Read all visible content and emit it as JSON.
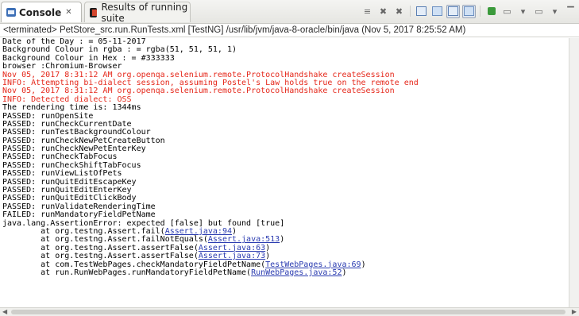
{
  "tabs": {
    "console_label": "Console",
    "console_close": "✕",
    "results_label": "Results of running suite"
  },
  "toolbar": {
    "icons": [
      "remove-all-terminated-icon",
      "terminate-icon",
      "remove-launch-icon",
      "clear-console-icon",
      "scroll-lock-icon",
      "word-wrap-icon",
      "show-on-output-icon",
      "pin-console-icon",
      "display-selected-console-icon",
      "open-console-icon",
      "minimize-icon"
    ]
  },
  "header": {
    "text": "<terminated> PetStore_src.run.RunTests.xml [TestNG] /usr/lib/jvm/java-8-oracle/bin/java (Nov 5, 2017 8:25:52 AM)"
  },
  "output": {
    "lines": [
      "Date of the Day : = 05-11-2017",
      "Background Colour in rgba : = rgba(51, 51, 51, 1)",
      "Background Colour in Hex : = #333333",
      "browser :Chromium-Browser",
      "Nov 05, 2017 8:31:12 AM org.openqa.selenium.remote.ProtocolHandshake createSession",
      "INFO: Attempting bi-dialect session, assuming Postel's Law holds true on the remote end",
      "Nov 05, 2017 8:31:12 AM org.openqa.selenium.remote.ProtocolHandshake createSession",
      "INFO: Detected dialect: OSS",
      "The rendering time is: 1344ms",
      "PASSED: runOpenSite",
      "PASSED: runCheckCurrentDate",
      "PASSED: runTestBackgroundColour",
      "PASSED: runCheckNewPetCreateButton",
      "PASSED: runCheckNewPetEnterKey",
      "PASSED: runCheckTabFocus",
      "PASSED: runCheckShiftTabFocus",
      "PASSED: runViewListOfPets",
      "PASSED: runQuitEditEscapeKey",
      "PASSED: runQuitEditEnterKey",
      "PASSED: runQuitEditClickBody",
      "PASSED: runValidateRenderingTime",
      "FAILED: runMandatoryFieldPetName",
      "java.lang.AssertionError: expected [false] but found [true]"
    ],
    "error_lines": [
      4,
      5,
      6,
      7
    ],
    "stack": [
      {
        "prefix": "        at org.testng.Assert.fail(",
        "link": "Assert.java:94",
        "suffix": ")"
      },
      {
        "prefix": "        at org.testng.Assert.failNotEquals(",
        "link": "Assert.java:513",
        "suffix": ")"
      },
      {
        "prefix": "        at org.testng.Assert.assertFalse(",
        "link": "Assert.java:63",
        "suffix": ")"
      },
      {
        "prefix": "        at org.testng.Assert.assertFalse(",
        "link": "Assert.java:73",
        "suffix": ")"
      },
      {
        "prefix": "        at com.TestWebPages.checkMandatoryFieldPetName(",
        "link": "TestWebPages.java:69",
        "suffix": ")"
      },
      {
        "prefix": "        at run.RunWebPages.runMandatoryFieldPetName(",
        "link": "RunWebPages.java:52",
        "suffix": ")"
      }
    ]
  },
  "colors": {
    "error": "#e5271a",
    "link": "#2a3bb0"
  }
}
